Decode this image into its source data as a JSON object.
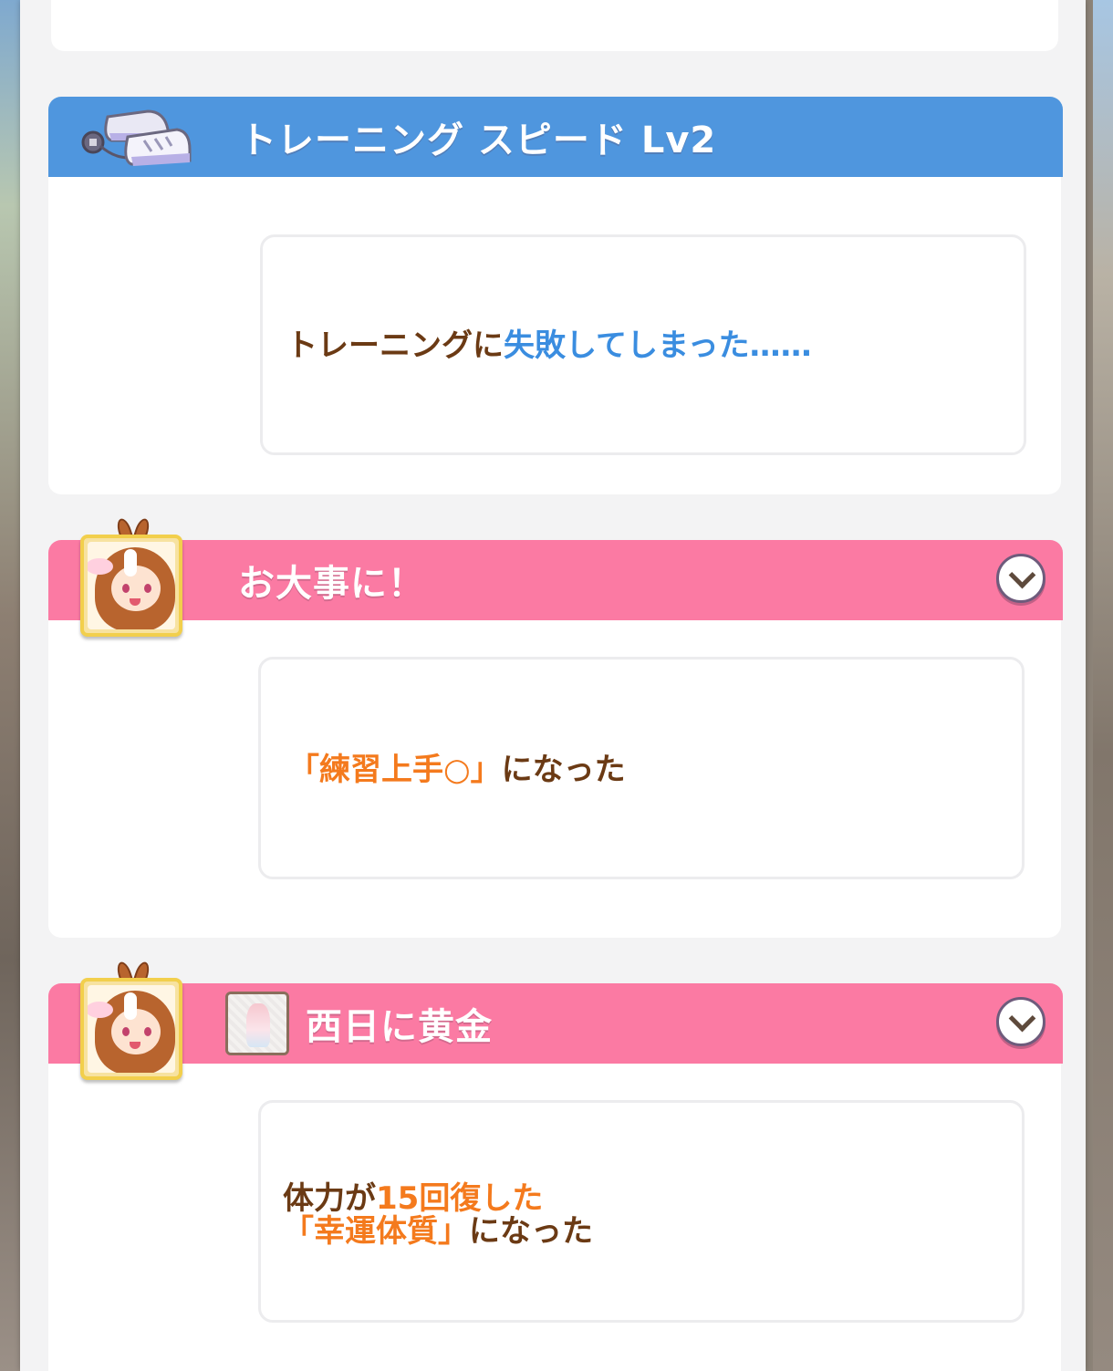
{
  "events": [
    {
      "header_style": "blue",
      "icon": "sneakers-icon",
      "title": "トレーニング スピード Lv2",
      "has_toggle": false,
      "message_segments": [
        {
          "text": "トレーニングに",
          "color": "brown"
        },
        {
          "text": "失敗してしまった……",
          "color": "blue"
        }
      ]
    },
    {
      "header_style": "pink",
      "icon": "character-avatar-icon",
      "title": "お大事に！",
      "has_toggle": true,
      "message_segments": [
        {
          "text": "「練習上手○」",
          "color": "orange"
        },
        {
          "text": "になった",
          "color": "brown"
        }
      ]
    },
    {
      "header_style": "pink",
      "icon": "character-avatar-icon",
      "sub_icon": "outfit-icon",
      "title": "西日に黄金",
      "has_toggle": true,
      "message_lines": [
        [
          {
            "text": "体力が",
            "color": "brown"
          },
          {
            "text": "15回復した",
            "color": "orange"
          }
        ],
        [
          {
            "text": "「幸運体質」",
            "color": "orange"
          },
          {
            "text": "になった",
            "color": "brown"
          }
        ]
      ]
    }
  ],
  "colors": {
    "header_blue": "#4f96de",
    "header_pink": "#fb7aa3",
    "text_brown": "#6b3a14",
    "text_blue": "#3a8de0",
    "text_orange": "#f47a1d"
  }
}
